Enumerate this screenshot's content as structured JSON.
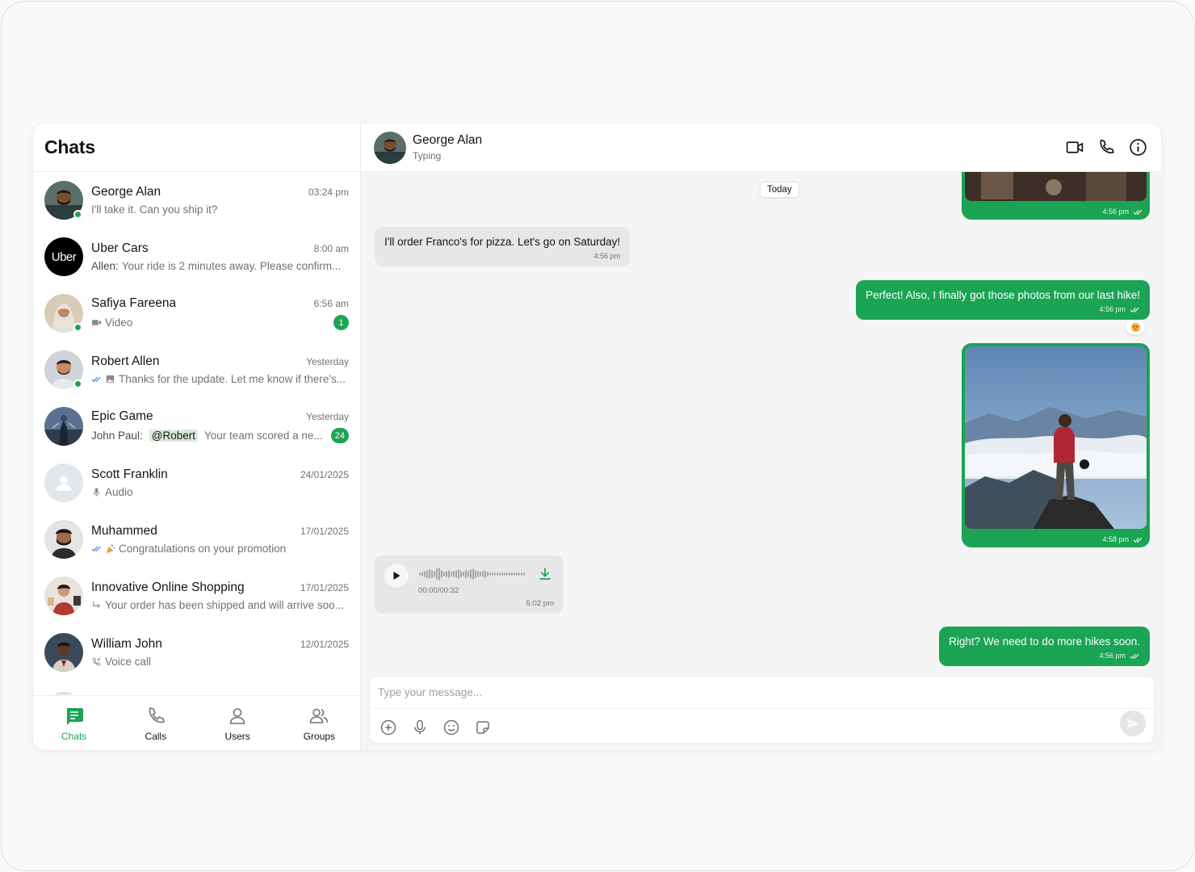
{
  "sidebar": {
    "title": "Chats",
    "chats": [
      {
        "name": "George Alan",
        "time": "03:24 pm",
        "preview": "I'll take it. Can you ship it?"
      },
      {
        "name": "Uber Cars",
        "time": "8:00 am",
        "sender": "Allen:",
        "preview": "Your ride is 2 minutes away. Please confirm...",
        "logo_text": "Uber"
      },
      {
        "name": "Safiya Fareena",
        "time": "6:56 am",
        "preview": "Video",
        "unread": "1"
      },
      {
        "name": "Robert Allen",
        "time": "Yesterday",
        "preview": "Thanks for the update. Let me know if there's..."
      },
      {
        "name": "Epic Game",
        "time": "Yesterday",
        "sender": "John Paul:",
        "mention": "@Robert",
        "preview": "Your team scored a ne...",
        "unread": "24"
      },
      {
        "name": "Scott Franklin",
        "time": "24/01/2025",
        "preview": "Audio"
      },
      {
        "name": "Muhammed",
        "time": "17/01/2025",
        "preview": "Congratulations on your promotion"
      },
      {
        "name": "Innovative Online Shopping",
        "time": "17/01/2025",
        "preview": "Your order has been shipped and will arrive soo..."
      },
      {
        "name": "William John",
        "time": "12/01/2025",
        "preview": "Voice call"
      }
    ]
  },
  "bottom_nav": [
    {
      "label": "Chats",
      "active": true
    },
    {
      "label": "Calls"
    },
    {
      "label": "Users"
    },
    {
      "label": "Groups"
    }
  ],
  "conversation": {
    "name": "George Alan",
    "status": "Typing",
    "day_label": "Today",
    "messages": {
      "top_image_time": "4:56 pm",
      "pizza": {
        "text": "I'll order Franco's for pizza. Let's go on Saturday!",
        "time": "4:56 pm"
      },
      "hike": {
        "text": "Perfect! Also, I finally got those photos from our last hike!",
        "time": "4:56 pm"
      },
      "photo_time": "4:58 pm",
      "voice": {
        "duration": "00:00/00:32",
        "time": "5:02 pm"
      },
      "more_hikes": {
        "text": "Right? We need to do more hikes soon.",
        "time": "4:56 pm"
      }
    }
  },
  "composer": {
    "placeholder": "Type your message..."
  },
  "colors": {
    "accent": "#1aa454",
    "incoming": "#e7e7e7",
    "read_tick": "#3b82d6"
  }
}
